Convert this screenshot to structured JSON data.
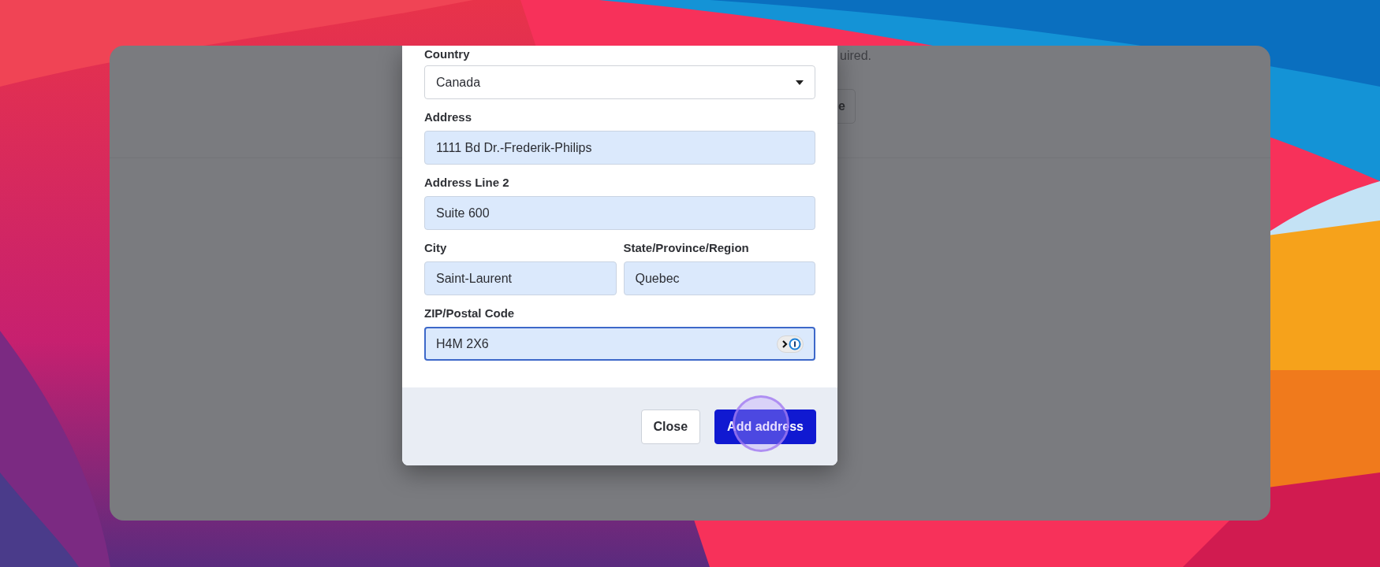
{
  "background": {
    "help_text": "uired.",
    "button_fragment": "e"
  },
  "dialog": {
    "rows": [
      [
        {
          "kind": "select",
          "label": "Country",
          "value": "Canada",
          "focused": false
        }
      ],
      [
        {
          "kind": "text",
          "label": "Address",
          "value": "1111 Bd Dr.-Frederik-Philips",
          "focused": false
        }
      ],
      [
        {
          "kind": "text",
          "label": "Address Line 2",
          "value": "Suite 600",
          "focused": false
        }
      ],
      [
        {
          "kind": "text",
          "label": "City",
          "value": "Saint-Laurent",
          "focused": false
        },
        {
          "kind": "text",
          "label": "State/Province/Region",
          "value": "Quebec",
          "focused": false
        }
      ],
      [
        {
          "kind": "text",
          "label": "ZIP/Postal Code",
          "value": "H4M 2X6",
          "focused": true
        }
      ]
    ],
    "buttons": [
      {
        "label": "Close",
        "kind": "secondary"
      },
      {
        "label": "Add address",
        "kind": "primary"
      }
    ]
  }
}
